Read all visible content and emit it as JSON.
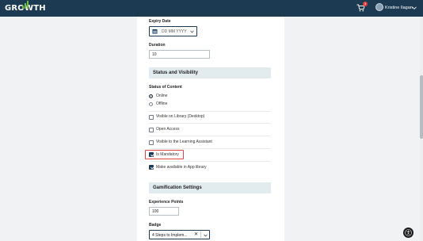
{
  "header": {
    "logo_text": "GROWTH",
    "cart_count": "3",
    "user_name": "Kristine Ilagan"
  },
  "form": {
    "expiry_date": {
      "label": "Expiry Date",
      "placeholder": "DD MM YYYY"
    },
    "duration": {
      "label": "Duration",
      "value": "10"
    },
    "status_section": {
      "title": "Status and Visibility"
    },
    "status_of_content": {
      "label": "Status of Content",
      "options": [
        {
          "label": "Online",
          "selected": true
        },
        {
          "label": "Offline",
          "selected": false
        }
      ]
    },
    "checkboxes": [
      {
        "label": "Visible on Library (Desktop)",
        "checked": false
      },
      {
        "label": "Open Access",
        "checked": false
      },
      {
        "label": "Visible to the Learning Assistant",
        "checked": false
      },
      {
        "label": "Is Mandatory",
        "checked": true
      },
      {
        "label": "Make available in App library",
        "checked": true
      }
    ],
    "gamification_section": {
      "title": "Gamification Settings"
    },
    "experience_points": {
      "label": "Experience Points",
      "value": "100"
    },
    "badge": {
      "label": "Badge",
      "value": "4 Steps to Implem..."
    }
  },
  "colors": {
    "topbar": "#1c3a52",
    "section_bg": "#e2ebee",
    "checkbox_checked": "#1d3a57",
    "highlight": "#e04848"
  }
}
